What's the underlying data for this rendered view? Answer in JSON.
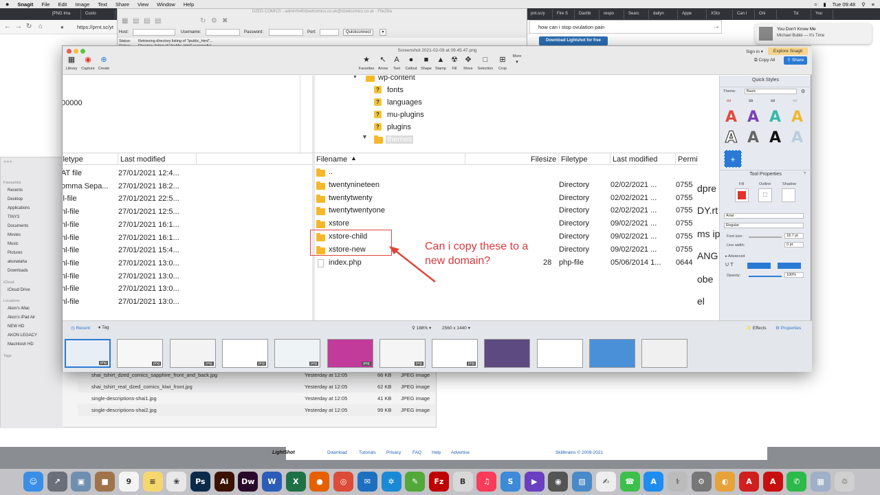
{
  "menubar": {
    "app": "Snagit",
    "items": [
      "File",
      "Edit",
      "Image",
      "Text",
      "Share",
      "View",
      "Window",
      "Help"
    ],
    "clock": "Tue 09:48"
  },
  "browser": {
    "tabs": [
      "[PNG Ima",
      "Custo",
      "pnt.sc/y",
      "Fire S",
      "Dashb",
      "respo",
      "Searc",
      "dailyn",
      "Appe",
      "XSto",
      "Can I",
      "Oni",
      "Tst",
      "You"
    ],
    "url": "https://prnt.sc/yt",
    "search_query": "how can i stop ovulation pain",
    "download_button": "Download Lightshot for free",
    "notification": {
      "title": "You Don't Know Me",
      "artist": "Michael Bublé — It's Time"
    }
  },
  "filezilla": {
    "title": "DZED COMICS - admin%40dzedcomics.co.uk@dzedcomics.co.uk - FileZilla",
    "host_label": "Host:",
    "username_label": "Username:",
    "password_label": "Password:",
    "port_label": "Port:",
    "quickconnect": "Quickconnect",
    "status_label": "Status:",
    "status_line1": "Retrieving directory listing of \"/public_html\"...",
    "status_line2": "Directory listing of \"/public_html\" successful"
  },
  "finder": {
    "sections": {
      "favourites": "Favourites",
      "icloud": "iCloud",
      "locations": "Locations",
      "tags": "Tags"
    },
    "favourites": [
      "Recents",
      "Desktop",
      "Applications",
      "TINY3",
      "Documents",
      "Movies",
      "Music",
      "Pictures",
      "akonataha",
      "Downloads"
    ],
    "icloud_items": [
      "iCloud Drive"
    ],
    "locations": [
      "Akon's iMac",
      "Akon's iPad Air",
      "NEW HD",
      "AKON LEGACY",
      "Macintosh HD"
    ],
    "files": [
      {
        "name": "shai_tshirt_dzed_comics_sapphire_front_and_back.jpg",
        "date": "Yesterday at 12:05",
        "size": "66 KB",
        "kind": "JPEG image"
      },
      {
        "name": "shai_tshirt_real_dzed_comics_kiwi_front.jpg",
        "date": "Yesterday at 12:05",
        "size": "62 KB",
        "kind": "JPEG image"
      },
      {
        "name": "single-descriptions-shai1.jpg",
        "date": "Yesterday at 12:05",
        "size": "41 KB",
        "kind": "JPEG image"
      },
      {
        "name": "single-descriptions-shai2.jpg",
        "date": "Yesterday at 12:05",
        "size": "99 KB",
        "kind": "JPEG image"
      }
    ]
  },
  "snagit": {
    "title": "Screenshot 2021-02-09 at 09.45.47.png",
    "left_tools": [
      "Library",
      "Capture",
      "Create"
    ],
    "tools": [
      "Favorites",
      "Arrow",
      "Text",
      "Callout",
      "Shape",
      "Stamp",
      "Fill",
      "Move",
      "Selection",
      "Crop"
    ],
    "more_label": "More",
    "sign_in": "Sign in ▾",
    "explore": "Explore Snagit",
    "copy_all": "Copy All",
    "share": "Share",
    "quick_styles_title": "Quick Styles",
    "theme_label": "Theme:",
    "theme_value": "Basic",
    "tool_properties_title": "Tool Properties",
    "fill_label": "Fill",
    "outline_label": "Outline",
    "shadow_label": "Shadow",
    "font_value": "Arial",
    "weight_value": "Regular",
    "font_size_label": "Font size:",
    "font_size_value": "18.7 pt",
    "line_width_label": "Line width:",
    "line_width_value": "0 pt",
    "advanced_label": "Advanced",
    "opacity_label": "Opacity:",
    "opacity_value": "100%",
    "bottom_bar": {
      "recent": "Recent",
      "tag": "Tag",
      "zoom": "188% ▾",
      "dimensions": "2560 x 1440 ▾",
      "effects": "Effects",
      "properties": "Properties"
    },
    "thumb_badge": "png",
    "accent": "#2a7ad5"
  },
  "screenshot": {
    "left_value": "00000",
    "left_columns": [
      "iletype",
      "Last modified"
    ],
    "left_rows": [
      {
        "type": "AT file",
        "modified": "27/01/2021 12:4..."
      },
      {
        "type": "omma Sepa...",
        "modified": "27/01/2021 18:2..."
      },
      {
        "type": "il-file",
        "modified": "27/01/2021 22:5..."
      },
      {
        "type": "nl-file",
        "modified": "27/01/2021 12:5..."
      },
      {
        "type": "nl-file",
        "modified": "27/01/2021 16:1..."
      },
      {
        "type": "nl-file",
        "modified": "27/01/2021 16:1..."
      },
      {
        "type": "nl-file",
        "modified": "27/01/2021 15:4..."
      },
      {
        "type": "nl-file",
        "modified": "27/01/2021 13:0..."
      },
      {
        "type": "nl-file",
        "modified": "27/01/2021 13:0..."
      },
      {
        "type": "nl-file",
        "modified": "27/01/2021 13:0..."
      },
      {
        "type": "nl-file",
        "modified": "27/01/2021 13:0..."
      }
    ],
    "tree": [
      "wp-content",
      "fonts",
      "languages",
      "mu-plugins",
      "plugins",
      "themes"
    ],
    "right_columns": [
      "Filename",
      "Filesize",
      "Filetype",
      "Last modified",
      "Permi"
    ],
    "right_rows": [
      {
        "name": "..",
        "size": "",
        "type": "",
        "modified": "",
        "perm": ""
      },
      {
        "name": "twentynineteen",
        "size": "",
        "type": "Directory",
        "modified": "02/02/2021 ...",
        "perm": "0755"
      },
      {
        "name": "twentytwenty",
        "size": "",
        "type": "Directory",
        "modified": "02/02/2021 ...",
        "perm": "0755"
      },
      {
        "name": "twentytwentyone",
        "size": "",
        "type": "Directory",
        "modified": "02/02/2021 ...",
        "perm": "0755"
      },
      {
        "name": "xstore",
        "size": "",
        "type": "Directory",
        "modified": "09/02/2021 ...",
        "perm": "0755"
      },
      {
        "name": "xstore-child",
        "size": "",
        "type": "Directory",
        "modified": "09/02/2021 ...",
        "perm": "0755"
      },
      {
        "name": "xstore-new",
        "size": "",
        "type": "Directory",
        "modified": "09/02/2021 ...",
        "perm": "0755"
      },
      {
        "name": "index.php",
        "size": "28",
        "type": "php-file",
        "modified": "05/06/2014 1...",
        "perm": "0644"
      }
    ],
    "annotation_line1": "Can i copy these to a",
    "annotation_line2": "new domain?",
    "annotation_color": "#d8383c",
    "peek_text": [
      "dpre",
      "DY.rt",
      "ms ip",
      "ANG",
      "obe",
      "el"
    ]
  },
  "lightshot_footer": {
    "logo": "LightShot",
    "links": [
      "Download",
      "Tutorials",
      "Privacy",
      "FAQ",
      "Help",
      "Advertise"
    ],
    "copyright": "Skillbrains © 2009-2021"
  },
  "dock": {
    "apps": [
      {
        "name": "Finder",
        "glyph": "☺",
        "color": "#3a8ee6"
      },
      {
        "name": "Launchpad",
        "glyph": "↗",
        "color": "#6b6f7a"
      },
      {
        "name": "Preview",
        "glyph": "▣",
        "color": "#6f8fb0"
      },
      {
        "name": "Notes Box",
        "glyph": "■",
        "color": "#a0734a"
      },
      {
        "name": "Calendar",
        "glyph": "9",
        "color": "#f4f4f4"
      },
      {
        "name": "Notes",
        "glyph": "≡",
        "color": "#f5d76e"
      },
      {
        "name": "Photos",
        "glyph": "❀",
        "color": "#e8e8e8"
      },
      {
        "name": "Photoshop",
        "glyph": "Ps",
        "color": "#0b2a4a"
      },
      {
        "name": "Illustrator",
        "glyph": "Ai",
        "color": "#3b1200"
      },
      {
        "name": "Dreamweaver",
        "glyph": "Dw",
        "color": "#2a0a2a"
      },
      {
        "name": "Word",
        "glyph": "W",
        "color": "#2b5cb8"
      },
      {
        "name": "Excel",
        "glyph": "X",
        "color": "#1e7145"
      },
      {
        "name": "Firefox",
        "glyph": "●",
        "color": "#e66000"
      },
      {
        "name": "Chrome",
        "glyph": "◎",
        "color": "#dd4b39"
      },
      {
        "name": "Thunderbird",
        "glyph": "✉",
        "color": "#1d6fbf"
      },
      {
        "name": "Safari",
        "glyph": "✲",
        "color": "#1a8ad6"
      },
      {
        "name": "Pencil",
        "glyph": "✎",
        "color": "#53a83a"
      },
      {
        "name": "FileZilla",
        "glyph": "Fz",
        "color": "#bf0000"
      },
      {
        "name": "BBEdit",
        "glyph": "B",
        "color": "#d8d8d8"
      },
      {
        "name": "Music",
        "glyph": "♫",
        "color": "#fa3c5a"
      },
      {
        "name": "Sublime",
        "glyph": "S",
        "color": "#3c8ad8"
      },
      {
        "name": "Player",
        "glyph": "▶",
        "color": "#6a3fc0"
      },
      {
        "name": "Reel",
        "glyph": "◉",
        "color": "#555"
      },
      {
        "name": "Image Capture",
        "glyph": "▨",
        "color": "#4a8ac8"
      },
      {
        "name": "TextEdit",
        "glyph": "✍",
        "color": "#eeeeee"
      },
      {
        "name": "FaceTime",
        "glyph": "☎",
        "color": "#3dbf4c"
      },
      {
        "name": "App Store",
        "glyph": "A",
        "color": "#1f8cf0"
      },
      {
        "name": "Utility",
        "glyph": "⚕",
        "color": "#bbbbbb"
      },
      {
        "name": "System Preferences",
        "glyph": "⚙",
        "color": "#777"
      },
      {
        "name": "Monitor",
        "glyph": "◐",
        "color": "#e8a23a"
      },
      {
        "name": "Acrobat",
        "glyph": "A",
        "color": "#d01f1f"
      },
      {
        "name": "Acrobat Reader",
        "glyph": "A",
        "color": "#c80f0f"
      },
      {
        "name": "WhatsApp",
        "glyph": "✆",
        "color": "#2cba4a"
      },
      {
        "name": "Screenshot Tool",
        "glyph": "▦",
        "color": "#9fb0c8"
      },
      {
        "name": "Trash",
        "glyph": "♲",
        "color": "#cfcfcf"
      }
    ]
  }
}
